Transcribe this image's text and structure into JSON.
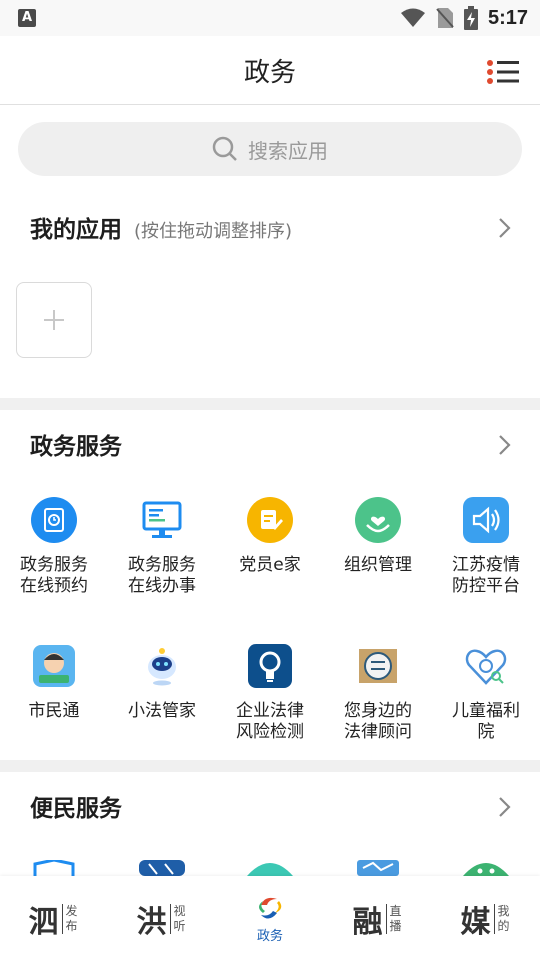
{
  "status_bar": {
    "left_icon": "A",
    "time": "5:17"
  },
  "header": {
    "title": "政务"
  },
  "search": {
    "placeholder": "搜索应用"
  },
  "my_apps": {
    "title": "我的应用",
    "hint": "(按住拖动调整排序)"
  },
  "sections": {
    "gov": {
      "title": "政务服务",
      "items": [
        {
          "label": "政务服务\n在线预约",
          "icon": "clock-calendar-icon",
          "color": "#1e8cf0"
        },
        {
          "label": "政务服务\n在线办事",
          "icon": "monitor-icon",
          "color": "#1e8cf0"
        },
        {
          "label": "党员e家",
          "icon": "note-pen-icon",
          "color": "#f7b500"
        },
        {
          "label": "组织管理",
          "icon": "hand-heart-icon",
          "color": "#4cc38a"
        },
        {
          "label": "江苏疫情\n防控平台",
          "icon": "speaker-icon",
          "color": "#3aa0ef"
        },
        {
          "label": "市民通",
          "icon": "citizen-avatar-icon",
          "color": "#3a8fde"
        },
        {
          "label": "小法管家",
          "icon": "robot-icon",
          "color": "#2c6fd1"
        },
        {
          "label": "企业法律\n风险检测",
          "icon": "lightbulb-icon",
          "color": "#0d4f8c"
        },
        {
          "label": "您身边的\n法律顾问",
          "icon": "law-badge-icon",
          "color": "#2e5a7a"
        },
        {
          "label": "儿童福利\n院",
          "icon": "child-heart-icon",
          "color": "#4a90d9"
        }
      ]
    },
    "convenience": {
      "title": "便民服务"
    }
  },
  "bottom_nav": [
    {
      "big": "泗",
      "small": "发布"
    },
    {
      "big": "洪",
      "small": "视听"
    },
    {
      "label": "政务",
      "active": true
    },
    {
      "big": "融",
      "small": "直播"
    },
    {
      "big": "媒",
      "small": "我的"
    }
  ]
}
